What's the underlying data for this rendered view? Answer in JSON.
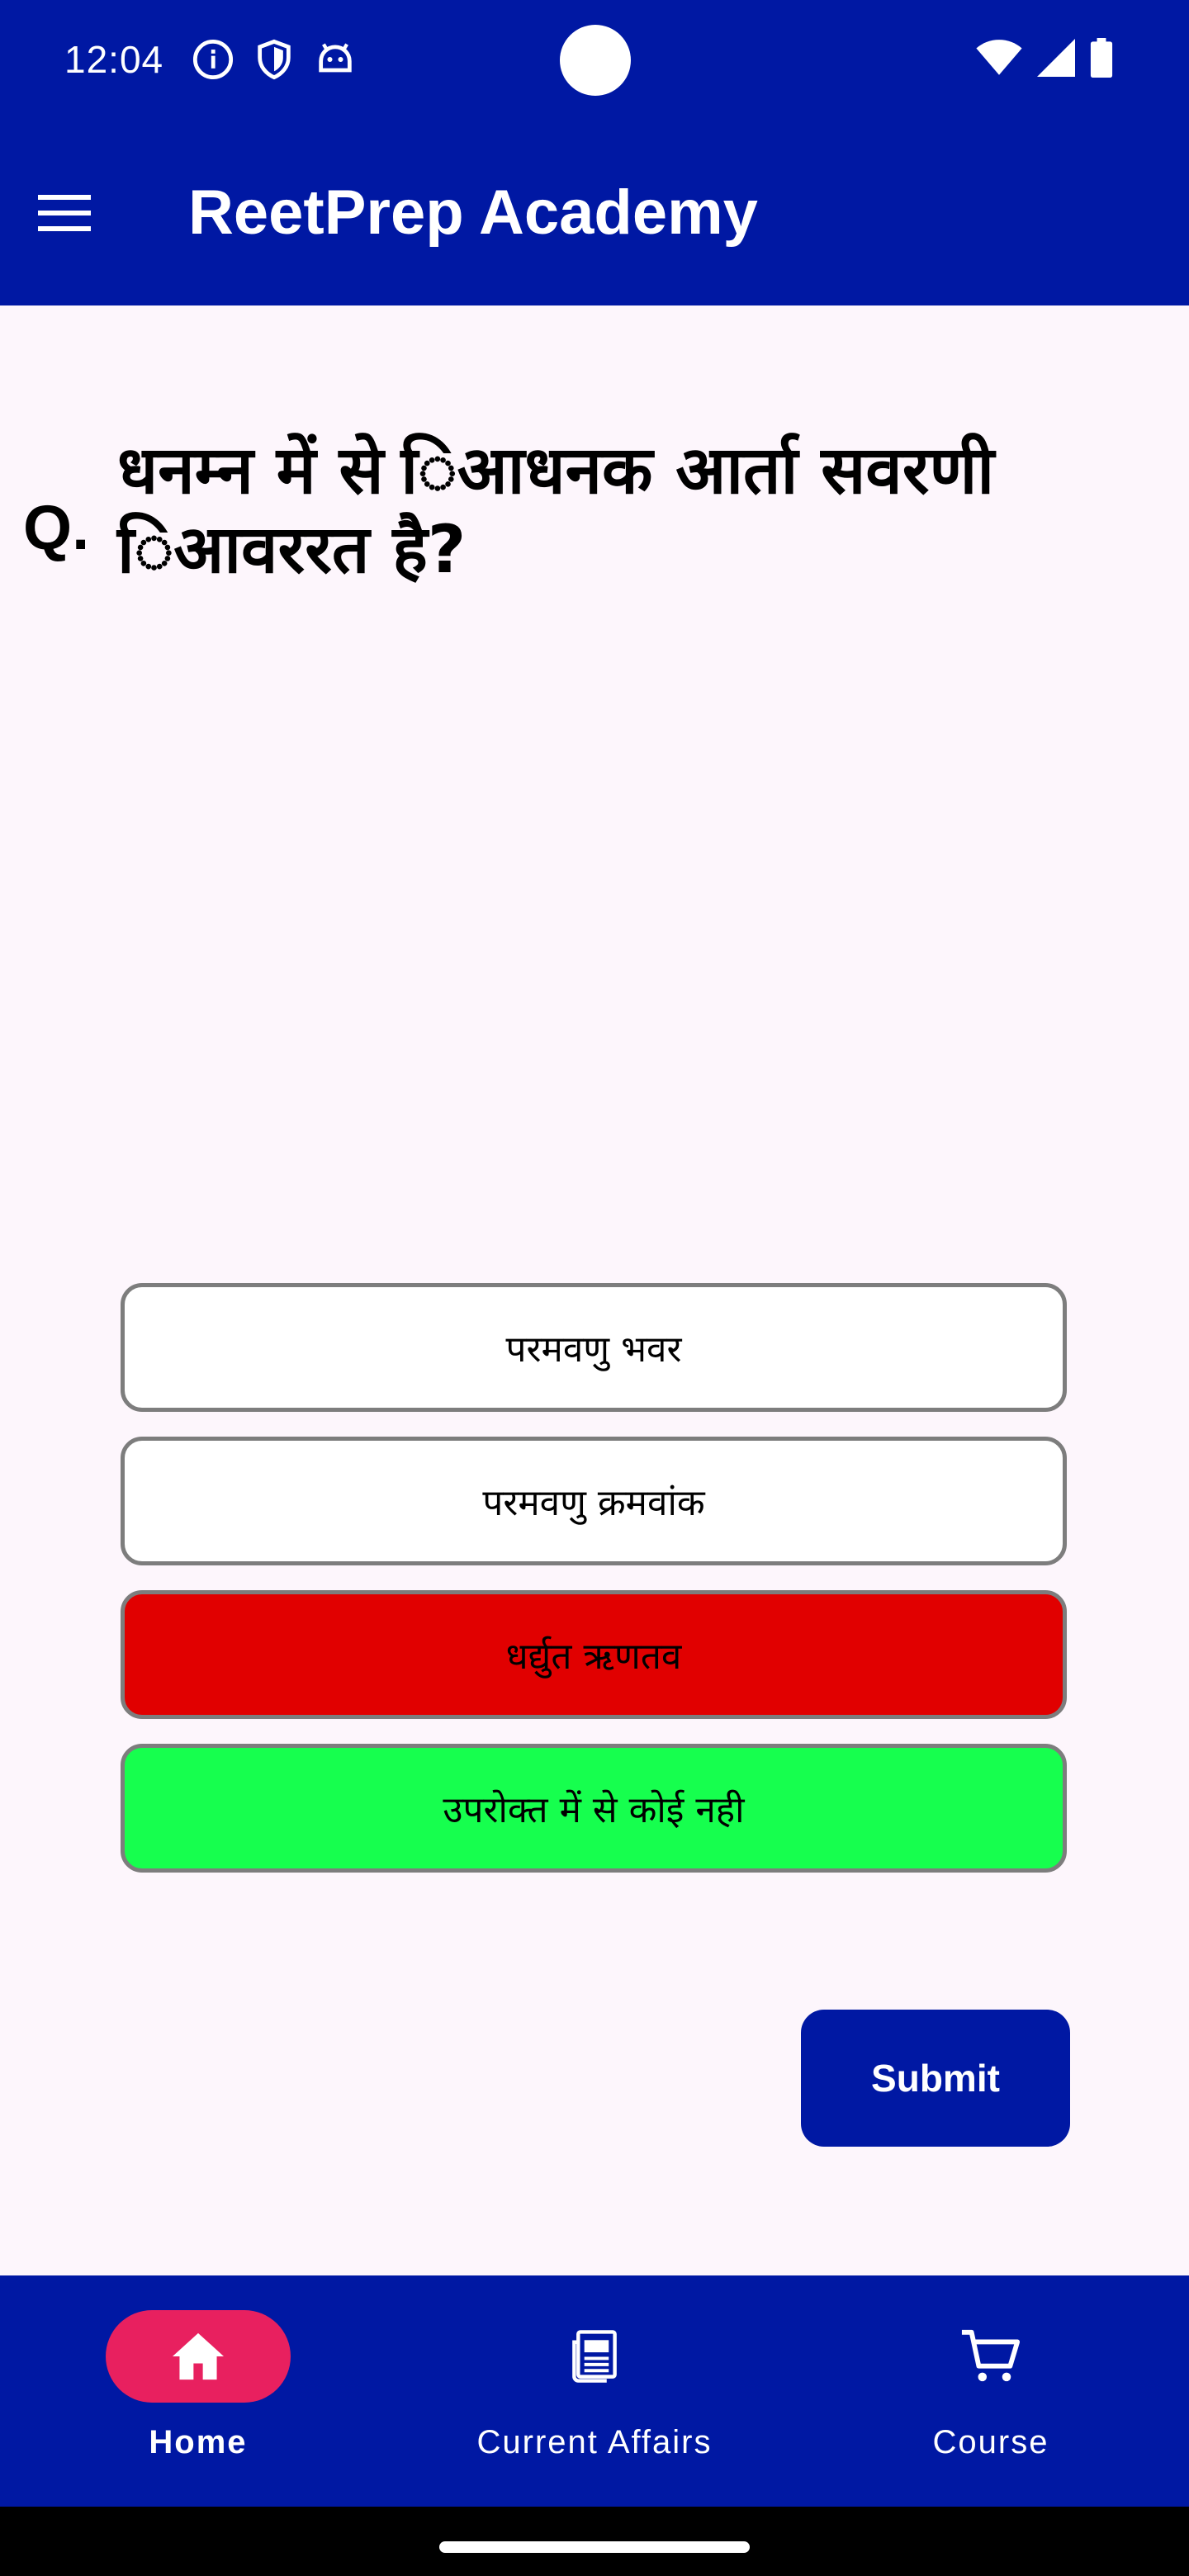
{
  "status_bar": {
    "time": "12:04",
    "icons_left": [
      "info-icon",
      "shield-icon",
      "android-icon"
    ],
    "icons_right": [
      "wifi-icon",
      "signal-icon",
      "battery-icon"
    ]
  },
  "app_bar": {
    "title": "ReetPrep Academy",
    "menu_icon": "hamburger-menu-icon"
  },
  "question": {
    "prefix": "Q.",
    "text": "धनम्न में से िआधनक आर्ता सवरणी िआवररत है?"
  },
  "options": [
    {
      "label": "परमवणु भवर",
      "state": "default",
      "color": "#ffffff"
    },
    {
      "label": "परमवणु क्रमवांक",
      "state": "default",
      "color": "#ffffff"
    },
    {
      "label": "धर्द्युत ऋणतव",
      "state": "wrong",
      "color": "#e10000"
    },
    {
      "label": "उपरोक्त में से कोई नही",
      "state": "correct",
      "color": "#16ff4e"
    }
  ],
  "submit_label": "Submit",
  "bottom_nav": {
    "items": [
      {
        "label": "Home",
        "icon": "home-icon",
        "active": true
      },
      {
        "label": "Current Affairs",
        "icon": "newspaper-icon",
        "active": false
      },
      {
        "label": "Course",
        "icon": "cart-icon",
        "active": false
      }
    ]
  },
  "colors": {
    "primary": "#0018a3",
    "accent": "#e8205f",
    "background": "#fdf6fc",
    "wrong": "#e10000",
    "correct": "#16ff4e"
  }
}
